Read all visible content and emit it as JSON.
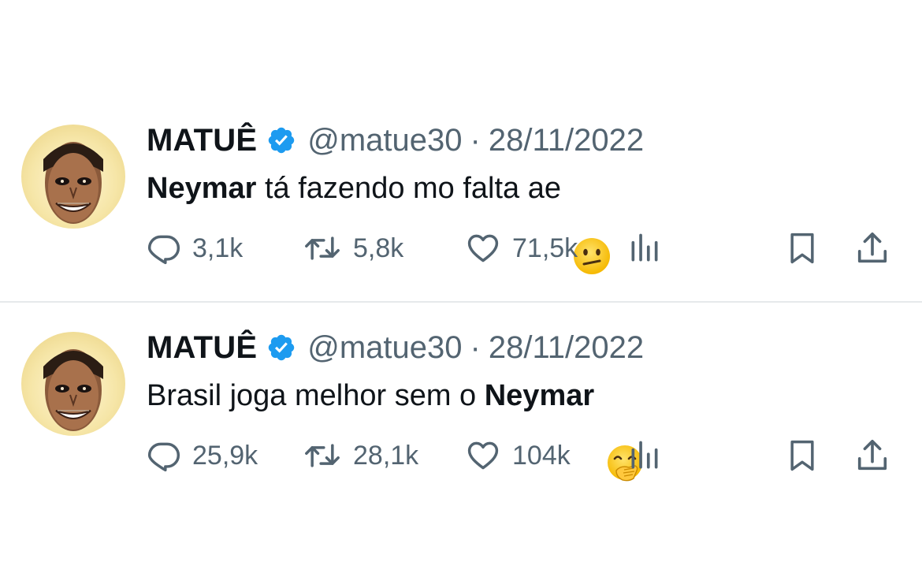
{
  "tweets": [
    {
      "author_name": "MATUÊ",
      "handle": "@matue30",
      "separator": "·",
      "date": "28/11/2022",
      "text_parts": [
        {
          "bold": true,
          "text": "Neymar"
        },
        {
          "bold": false,
          "text": " tá fazendo mo falta ae"
        }
      ],
      "emoji_icon": "confused-face-emoji",
      "replies": "3,1k",
      "retweets": "5,8k",
      "likes": "71,5k"
    },
    {
      "author_name": "MATUÊ",
      "handle": "@matue30",
      "separator": "·",
      "date": "28/11/2022",
      "text_parts": [
        {
          "bold": false,
          "text": "Brasil joga melhor sem o "
        },
        {
          "bold": true,
          "text": "Neymar"
        }
      ],
      "emoji_icon": "face-with-hand-over-mouth-emoji",
      "replies": "25,9k",
      "retweets": "28,1k",
      "likes": "104k"
    }
  ],
  "colors": {
    "text_primary": "#0f1419",
    "text_secondary": "#536471",
    "verified_blue": "#1d9bf0",
    "divider": "#e6e9eb"
  }
}
